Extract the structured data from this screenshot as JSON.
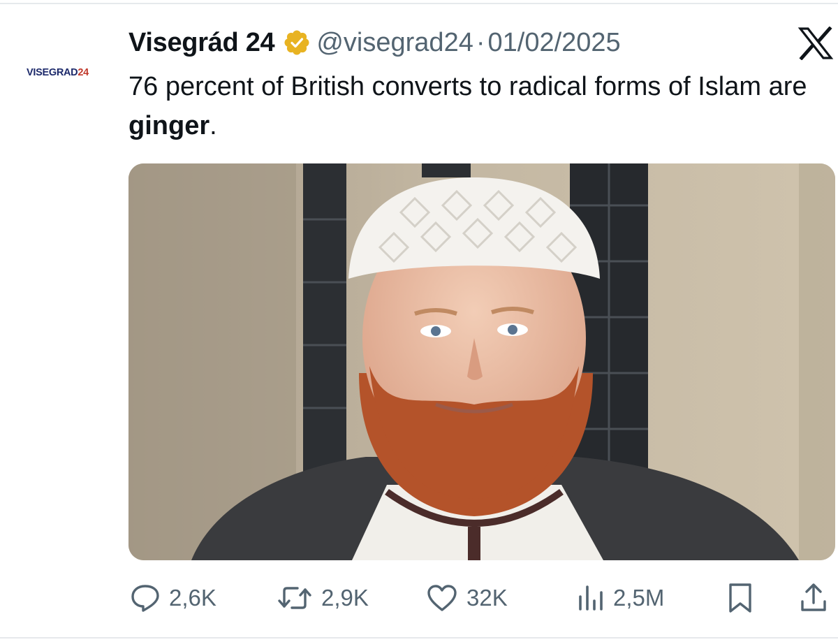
{
  "author": {
    "avatar": {
      "text_primary": "VISEGRAD",
      "text_accent": "24"
    },
    "name": "Visegrád 24",
    "verified_icon": "gold-verified-badge-icon",
    "handle": "@visegrad24",
    "separator": "·",
    "date": "01/02/2025"
  },
  "platform_icon": "x-logo-icon",
  "tweet": {
    "text_before": "76 percent of British converts to radical forms of Islam are ",
    "text_bold": "ginger",
    "text_after": "."
  },
  "media": {
    "alt": ""
  },
  "actions": {
    "reply": {
      "icon": "reply-icon",
      "count": "2,6K"
    },
    "retweet": {
      "icon": "retweet-icon",
      "count": "2,9K"
    },
    "like": {
      "icon": "heart-icon",
      "count": "32K"
    },
    "views": {
      "icon": "views-icon",
      "count": "2,5M"
    },
    "bookmark": {
      "icon": "bookmark-icon"
    },
    "share": {
      "icon": "share-icon"
    }
  },
  "colors": {
    "text": "#0f1419",
    "secondary": "#536471",
    "badge": "#e8b322",
    "avatar_primary": "#1d2a6b",
    "avatar_accent": "#c0392b",
    "divider": "#e6e9ec"
  }
}
